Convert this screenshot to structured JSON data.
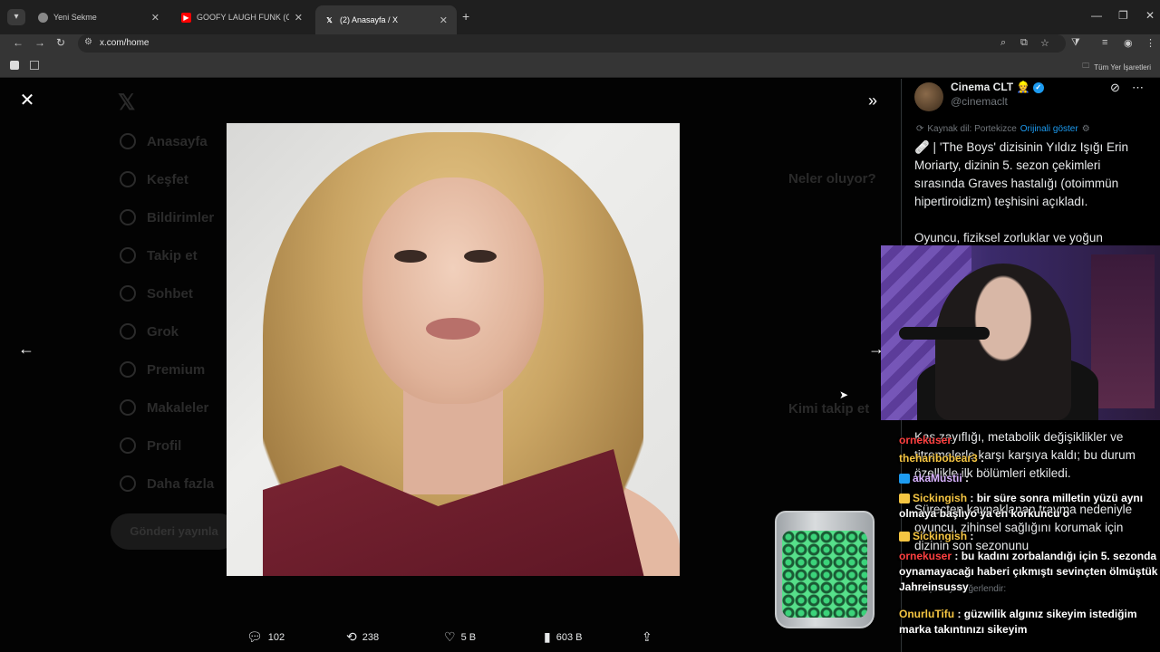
{
  "browser": {
    "tabs": [
      {
        "title": "Yeni Sekme",
        "active": false
      },
      {
        "title": "GOOFY LAUGH FUNK (Official A",
        "active": false
      },
      {
        "title": "(2) Anasayfa / X",
        "active": true
      }
    ],
    "url": "x.com/home",
    "bookmarks_all": "Tüm Yer İşaretleri"
  },
  "background": {
    "nav_items": [
      "Anasayfa",
      "Keşfet",
      "Bildirimler",
      "Takip et",
      "Sohbet",
      "Grok",
      "Premium",
      "Makaleler",
      "Profil",
      "Daha fazla"
    ],
    "post_button": "Gönderi yayınla",
    "right_items": [
      "Neler oluyor?",
      "Kimi takip et"
    ]
  },
  "media": {
    "actions": {
      "replies": "102",
      "reposts": "238",
      "likes": "5 B",
      "views": "603 B"
    }
  },
  "tweet": {
    "author": "Cinema CLT",
    "handle": "@cinemaclt",
    "source_lang": "Kaynak dil: Portekizce",
    "show_original": "Orijinali göster",
    "paragraphs": [
      "🩹 | 'The Boys' dizisinin Yıldız Işığı Erin Moriarty, dizinin 5. sezon çekimleri sırasında Graves hastalığı (otoimmün hipertiroidizm) teşhisini açıkladı.",
      "Oyuncu, fiziksel zorluklar ve yoğun",
      "Kas zayıflığı, metabolik değişiklikler ve titremelerle karşı karşıya kaldı; bu durum özellikle ilk bölümleri etkiledi.",
      "Süreçten kaynaklanan travma nedeniyle oyuncu, zihinsel sağlığını korumak için dizinin son sezonunu"
    ],
    "rate_translation": "Bu çeviriyi değerlendir:"
  },
  "chat": [
    {
      "user": "ornekuser",
      "text": "",
      "color": "#ff4040"
    },
    {
      "user": "theharibobear3",
      "text": "",
      "color": "#f5c542"
    },
    {
      "user": "akaMustii",
      "text": "",
      "color": "#d9b3ff"
    },
    {
      "user": "Sickingish",
      "text": "bir süre sonra milletin yüzü aynı olmaya başlıyo ya en korkuncu o",
      "color": "#f5c542"
    },
    {
      "user": "Sickingish",
      "text": "",
      "color": "#f5c542"
    },
    {
      "user": "ornekuser",
      "text": "bu kadını zorbalandığı için 5. sezonda oynamayacağı haberi çıkmıştı sevinçten ölmüştük Jahreinsussy",
      "color": "#ff4040"
    },
    {
      "user": "OnurluTifu",
      "text": "güzwilik algınız sikeyim istediğim marka takıntınızı sikeyim",
      "color": "#f5c542"
    }
  ],
  "colors": {
    "accent": "#1d9bf0",
    "chrome_bg": "#1f1f1f",
    "dress": "#7a2433"
  }
}
